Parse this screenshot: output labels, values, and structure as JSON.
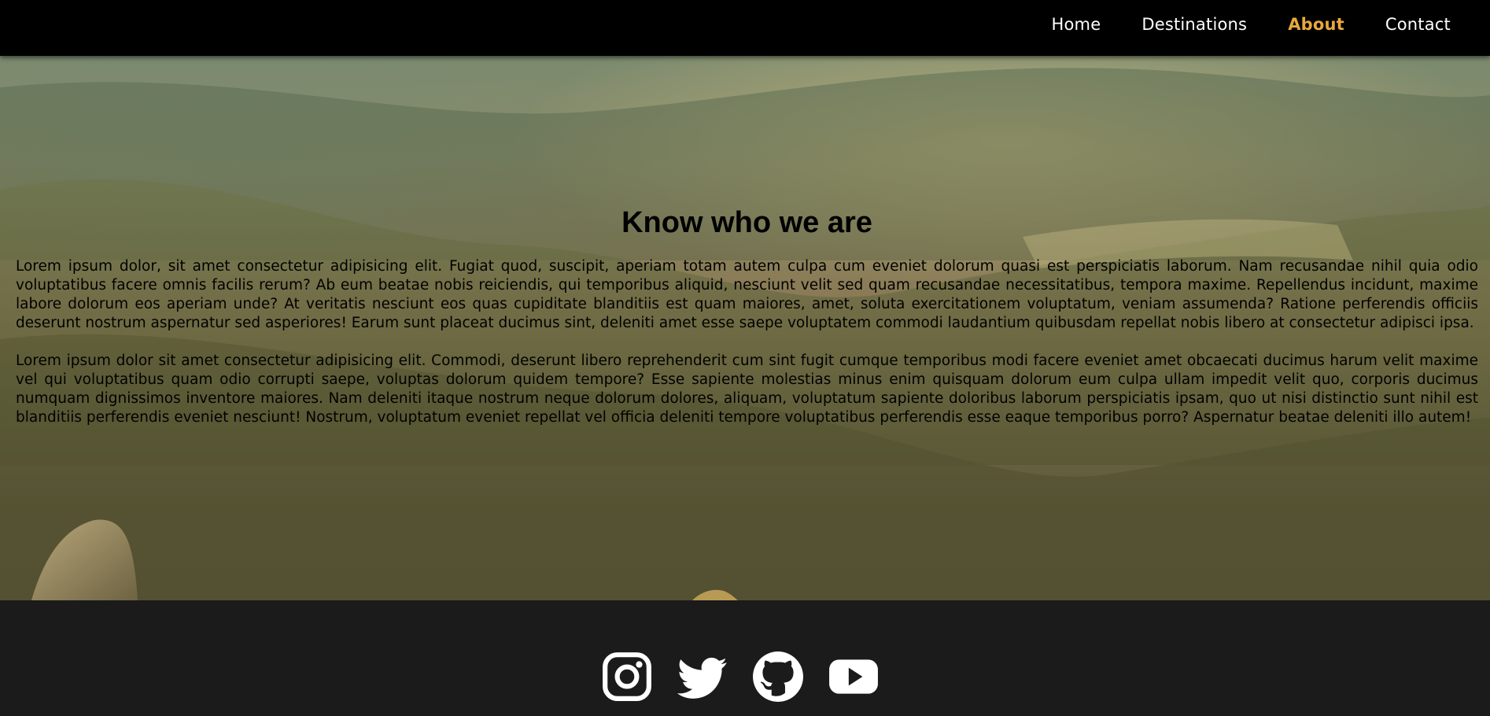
{
  "nav": {
    "links": [
      {
        "label": "Home",
        "active": false
      },
      {
        "label": "Destinations",
        "active": false
      },
      {
        "label": "About",
        "active": true
      },
      {
        "label": "Contact",
        "active": false
      }
    ],
    "active_color": "#e8a93c"
  },
  "hero": {
    "title": "Know who we are",
    "paragraphs": [
      "Lorem ipsum dolor, sit amet consectetur adipisicing elit. Fugiat quod, suscipit, aperiam totam autem culpa cum eveniet dolorum quasi est perspiciatis laborum. Nam recusandae nihil quia odio voluptatibus facere omnis facilis rerum? Ab eum beatae nobis reiciendis, qui temporibus aliquid, nesciunt velit sed quam recusandae necessitatibus, tempora maxime. Repellendus incidunt, maxime labore dolorum eos aperiam unde? At veritatis nesciunt eos quas cupiditate blanditiis est quam maiores, amet, soluta exercitationem voluptatum, veniam assumenda? Ratione perferendis officiis deserunt nostrum aspernatur sed asperiores! Earum sunt placeat ducimus sint, deleniti amet esse saepe voluptatem commodi laudantium quibusdam repellat nobis libero at consectetur adipisci ipsa.",
      "Lorem ipsum dolor sit amet consectetur adipisicing elit. Commodi, deserunt libero reprehenderit cum sint fugit cumque temporibus modi facere eveniet amet obcaecati ducimus harum velit maxime vel qui voluptatibus quam odio corrupti saepe, voluptas dolorum quidem tempore? Esse sapiente molestias minus enim quisquam dolorum eum culpa ullam impedit velit quo, corporis ducimus numquam dignissimos inventore maiores. Nam deleniti itaque nostrum neque dolorum dolores, aliquam, voluptatum sapiente doloribus laborum perspiciatis ipsam, quo ut nisi distinctio sunt nihil est blanditiis perferendis eveniet nesciunt! Nostrum, voluptatum eveniet repellat vel officia deleniti tempore voluptatibus perferendis esse eaque temporibus porro? Aspernatur beatae deleniti illo autem!"
    ],
    "background_image": "forested-mountain-valley"
  },
  "footer": {
    "social_icons": [
      "instagram-icon",
      "twitter-icon",
      "github-icon",
      "youtube-icon"
    ]
  }
}
